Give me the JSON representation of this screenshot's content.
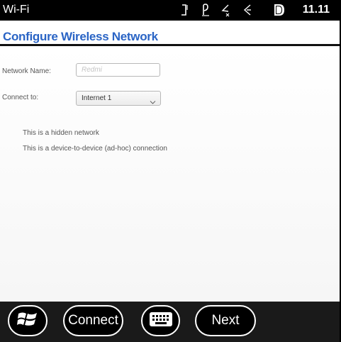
{
  "status_bar": {
    "title": "Wi-Fi",
    "time": "11.11",
    "icons": [
      "signal-icon",
      "connectivity-icon",
      "sound-off-icon",
      "wifi-icon",
      "battery-icon"
    ]
  },
  "header": {
    "title": "Configure Wireless Network"
  },
  "form": {
    "network_name_label": "Network Name:",
    "network_name_value": "",
    "network_name_placeholder": "Redmi",
    "connect_to_label": "Connect to:",
    "connect_to_selected": "Internet 1",
    "hidden_network_text": "This is a hidden network",
    "adhoc_text": "This is a device-to-device (ad-hoc) connection"
  },
  "softkeys": {
    "start_icon": "windows-start-icon",
    "connect_label": "Connect",
    "keyboard_icon": "keyboard-icon",
    "next_label": "Next"
  },
  "colors": {
    "status_bar_bg": "#000000",
    "title_blue": "#2a64c5",
    "softbar_bg": "#1a1a1a"
  }
}
